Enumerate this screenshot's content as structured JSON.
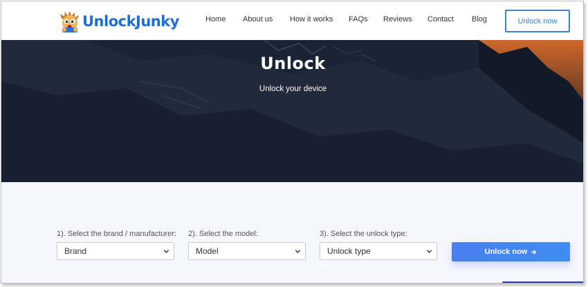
{
  "header": {
    "logo_text": "UnlockJunky",
    "nav": [
      "Home",
      "About us",
      "How it works",
      "FAQs",
      "Reviews",
      "Contact",
      "Blog"
    ],
    "cta_label": "Unlock now"
  },
  "hero": {
    "title": "Unlock",
    "subtitle": "Unlock your device"
  },
  "form": {
    "brand_label": "1). Select the brand / manufacturer:",
    "brand_value": "Brand",
    "model_label": "2). Select the model:",
    "model_value": "Model",
    "type_label": "3). Select the unlock type:",
    "type_value": "Unlock type",
    "submit_label": "Unlock now"
  },
  "colors": {
    "brand_blue": "#1f6fd1",
    "accent_blue": "#3b7fd6",
    "button_blue": "#4a7ff0",
    "hero_dark": "#1a2333",
    "form_bg": "#f6f6fe"
  },
  "icons": {
    "logo": "mascot-icon",
    "select_caret": "chevron-down-icon",
    "submit_arrow": "arrow-right-icon"
  }
}
